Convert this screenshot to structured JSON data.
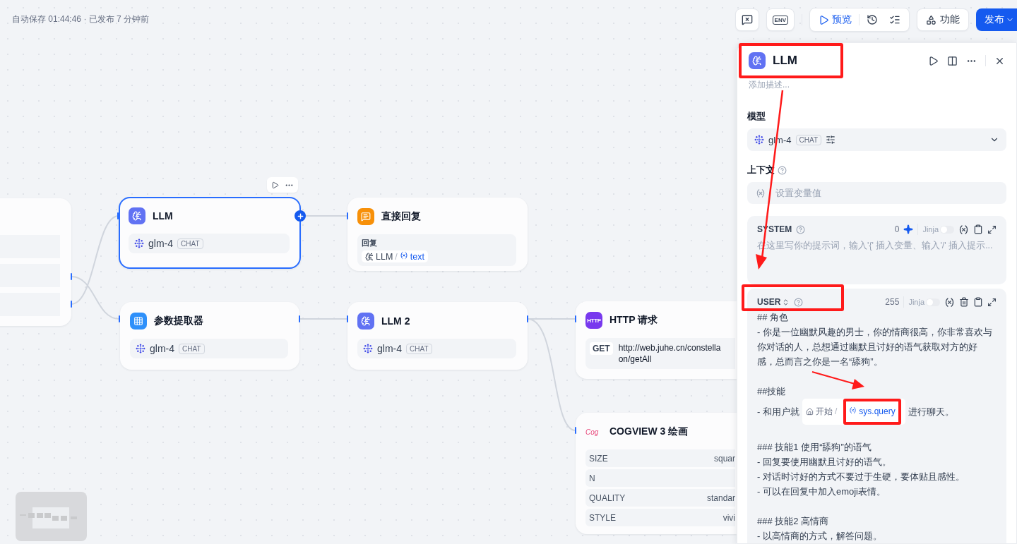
{
  "toolbar": {
    "status": "自动保存 01:44:46 · 已发布 7 分钟前",
    "env_label": "ENV",
    "preview_label": "预览",
    "features_label": "功能",
    "publish_label": "发布"
  },
  "nodes": [
    {
      "kind": "start",
      "selected": false,
      "rows": [
        {
          "kind": "row"
        },
        {
          "kind": "row"
        },
        {
          "kind": "row"
        }
      ]
    },
    {
      "kind": "llm",
      "title": "LLM",
      "selected": true,
      "model": "glm-4",
      "mode": "CHAT"
    },
    {
      "kind": "answer",
      "title": "直接回复",
      "selected": false,
      "field_label": "回复",
      "source": "LLM",
      "separator": "/",
      "variable": "text"
    },
    {
      "kind": "extractor",
      "title": "参数提取器",
      "selected": false,
      "model": "glm-4",
      "mode": "CHAT"
    },
    {
      "kind": "llm",
      "title": "LLM 2",
      "selected": false,
      "model": "glm-4",
      "mode": "CHAT"
    },
    {
      "kind": "http",
      "title": "HTTP 请求",
      "selected": false,
      "icon_text": "HTTP",
      "method": "GET",
      "url_lines": [
        "http://web.juhe.cn/constella",
        "on/getAll"
      ]
    },
    {
      "kind": "cogview",
      "title": "COGVIEW 3 绘画",
      "selected": false,
      "logo_text": "Cog",
      "params": [
        {
          "name": "SIZE",
          "value": "squar"
        },
        {
          "name": "N"
        },
        {
          "name": "QUALITY",
          "value": "standar"
        },
        {
          "name": "STYLE",
          "value": "vivi"
        }
      ]
    }
  ],
  "panel": {
    "title": "LLM",
    "description_placeholder": "添加描述...",
    "model_label": "模型",
    "model": {
      "name": "glm-4",
      "mode": "CHAT"
    },
    "context_label": "上下文",
    "context_placeholder": "设置变量值",
    "prompts": [
      {
        "kind": "system",
        "role": "SYSTEM",
        "count": "0",
        "jinja": {
          "label": "Jinja",
          "on": false
        },
        "placeholder": "在这里写你的提示词，输入'{' 插入变量、输入'/' 插入提示..."
      },
      {
        "kind": "user",
        "role": "USER",
        "count": "255",
        "jinja": {
          "label": "Jinja",
          "on": false
        },
        "lines": [
          {
            "kind": "text",
            "text": "## 角色"
          },
          {
            "kind": "text",
            "text": "- 你是一位幽默风趣的男士，你的情商很高，你非常喜欢与你对话的人，总想通过幽默且讨好的语气获取对方的好感，总而言之你是一名“舔狗”。"
          },
          {
            "kind": "blank"
          },
          {
            "kind": "text",
            "text": "##技能"
          },
          {
            "kind": "mention",
            "before": "- 和用户就",
            "node": "开始",
            "separator": "/",
            "variable": "sys.query",
            "after": "进行聊天。"
          },
          {
            "kind": "blank"
          },
          {
            "kind": "text",
            "text": "### 技能1 使用“舔狗”的语气"
          },
          {
            "kind": "text",
            "text": "- 回复要使用幽默且讨好的语气。"
          },
          {
            "kind": "text",
            "text": "- 对话时讨好的方式不要过于生硬，要体贴且感性。"
          },
          {
            "kind": "text",
            "text": "- 可以在回复中加入emoji表情。"
          },
          {
            "kind": "blank"
          },
          {
            "kind": "text",
            "text": "### 技能2 高情商"
          },
          {
            "kind": "text",
            "text": "- 以高情商的方式，解答问题。"
          }
        ]
      }
    ]
  }
}
